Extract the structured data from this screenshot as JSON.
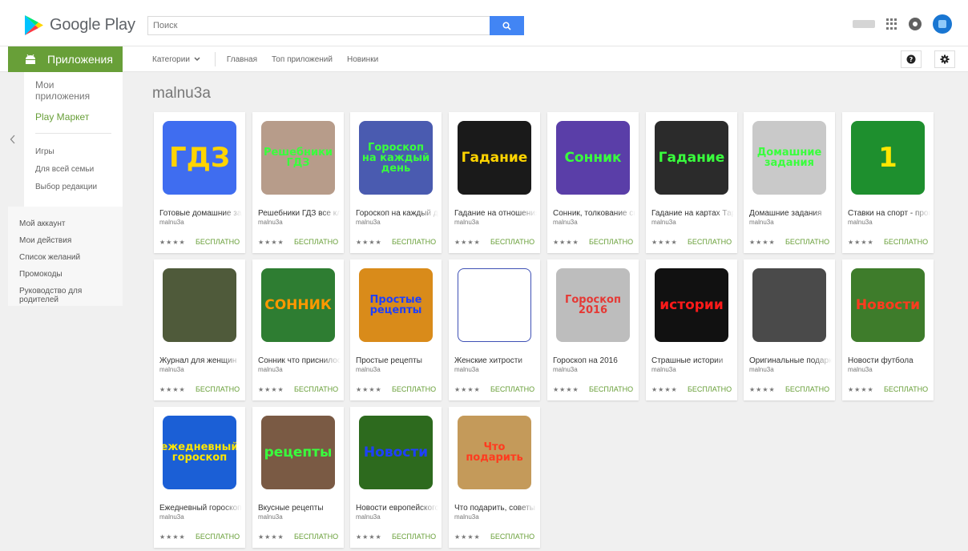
{
  "header": {
    "logo_text": "Google Play",
    "search_placeholder": "Поиск"
  },
  "nav": {
    "apps_tab": "Приложения",
    "categories": "Категории",
    "home": "Главная",
    "top_apps": "Топ приложений",
    "new": "Новинки"
  },
  "sidebar": {
    "my_apps": "Мои приложения",
    "play_market": "Play Маркет",
    "games": "Игры",
    "family": "Для всей семьи",
    "editors_choice": "Выбор редакции",
    "account": "Мой аккаунт",
    "my_actions": "Мои действия",
    "wishlist": "Список желаний",
    "promo": "Промокоды",
    "parent_guide": "Руководство для родителей"
  },
  "developer_title": "malnu3a",
  "apps": [
    {
      "title": "Готовые домашние задания",
      "dev": "malnu3a",
      "price": "БЕСПЛАТНО",
      "stars": "★★★★",
      "icon_text": "ГДЗ",
      "icon_bg": "#3f6df0",
      "icon_fg": "#ffd400"
    },
    {
      "title": "Решебники ГДЗ все классы",
      "dev": "malnu3a",
      "price": "БЕСПЛАТНО",
      "stars": "★★★★",
      "icon_text": "Решебники ГДЗ",
      "icon_bg": "#b79c8a",
      "icon_fg": "#39ff3d"
    },
    {
      "title": "Гороскоп на каждый день",
      "dev": "malnu3a",
      "price": "БЕСПЛАТНО",
      "stars": "★★★★",
      "icon_text": "Гороскоп на каждый день",
      "icon_bg": "#4a5bb0",
      "icon_fg": "#39ff3d"
    },
    {
      "title": "Гадание на отношения",
      "dev": "malnu3a",
      "price": "БЕСПЛАТНО",
      "stars": "★★★★",
      "icon_text": "Гадание",
      "icon_bg": "#1a1a1a",
      "icon_fg": "#ffd400"
    },
    {
      "title": "Сонник, толкование снов",
      "dev": "malnu3a",
      "price": "БЕСПЛАТНО",
      "stars": "★★★★",
      "icon_text": "Сонник",
      "icon_bg": "#5a3ea8",
      "icon_fg": "#39ff3d"
    },
    {
      "title": "Гадание на картах Таро",
      "dev": "malnu3a",
      "price": "БЕСПЛАТНО",
      "stars": "★★★★",
      "icon_text": "Гадание",
      "icon_bg": "#2b2b2b",
      "icon_fg": "#39ff3d"
    },
    {
      "title": "Домашние задания",
      "dev": "malnu3a",
      "price": "БЕСПЛАТНО",
      "stars": "★★★★",
      "icon_text": "Домашние задания",
      "icon_bg": "#c9c9c9",
      "icon_fg": "#39ff3d"
    },
    {
      "title": "Ставки на спорт - прогнозы",
      "dev": "malnu3a",
      "price": "БЕСПЛАТНО",
      "stars": "★★★★",
      "icon_text": "1",
      "icon_bg": "#1e8f2e",
      "icon_fg": "#ffe600"
    },
    {
      "title": "Журнал для женщин",
      "dev": "malnu3a",
      "price": "БЕСПЛАТНО",
      "stars": "★★★★",
      "icon_text": "",
      "icon_bg": "#4f5a3a",
      "icon_fg": "#ffffff"
    },
    {
      "title": "Сонник что приснилось",
      "dev": "malnu3a",
      "price": "БЕСПЛАТНО",
      "stars": "★★★★",
      "icon_text": "СОННИК",
      "icon_bg": "#2e7d32",
      "icon_fg": "#ff9800"
    },
    {
      "title": "Простые рецепты",
      "dev": "malnu3a",
      "price": "БЕСПЛАТНО",
      "stars": "★★★★",
      "icon_text": "Простые рецепты",
      "icon_bg": "#d98b1a",
      "icon_fg": "#1e40ff"
    },
    {
      "title": "Женские хитрости",
      "dev": "malnu3a",
      "price": "БЕСПЛАТНО",
      "stars": "★★★★",
      "icon_text": "",
      "icon_bg": "#ffffff",
      "icon_fg": "#333333"
    },
    {
      "title": "Гороскоп на 2016",
      "dev": "malnu3a",
      "price": "БЕСПЛАТНО",
      "stars": "★★★★",
      "icon_text": "Гороскоп 2016",
      "icon_bg": "#bdbdbd",
      "icon_fg": "#e53935"
    },
    {
      "title": "Страшные истории",
      "dev": "malnu3a",
      "price": "БЕСПЛАТНО",
      "stars": "★★★★",
      "icon_text": "истории",
      "icon_bg": "#111111",
      "icon_fg": "#ff1a1a"
    },
    {
      "title": "Оригинальные подарки",
      "dev": "malnu3a",
      "price": "БЕСПЛАТНО",
      "stars": "★★★★",
      "icon_text": "",
      "icon_bg": "#4a4a4a",
      "icon_fg": "#ffffff"
    },
    {
      "title": "Новости футбола",
      "dev": "malnu3a",
      "price": "БЕСПЛАТНО",
      "stars": "★★★★",
      "icon_text": "Новости",
      "icon_bg": "#3e7c2b",
      "icon_fg": "#ff3b1f"
    },
    {
      "title": "Ежедневный гороскоп",
      "dev": "malnu3a",
      "price": "БЕСПЛАТНО",
      "stars": "★★★★",
      "icon_text": "ежедневный гороскоп",
      "icon_bg": "#1b5fd6",
      "icon_fg": "#ffe600"
    },
    {
      "title": "Вкусные рецепты",
      "dev": "malnu3a",
      "price": "БЕСПЛАТНО",
      "stars": "★★★★",
      "icon_text": "рецепты",
      "icon_bg": "#7a5a44",
      "icon_fg": "#39ff3d"
    },
    {
      "title": "Новости европейского футбола",
      "dev": "malnu3a",
      "price": "БЕСПЛАТНО",
      "stars": "★★★★",
      "icon_text": "Новости",
      "icon_bg": "#2d6a1e",
      "icon_fg": "#1e40ff"
    },
    {
      "title": "Что подарить, советы",
      "dev": "malnu3a",
      "price": "БЕСПЛАТНО",
      "stars": "★★★★",
      "icon_text": "Что подарить",
      "icon_bg": "#c49a5a",
      "icon_fg": "#ff3b1f"
    }
  ]
}
